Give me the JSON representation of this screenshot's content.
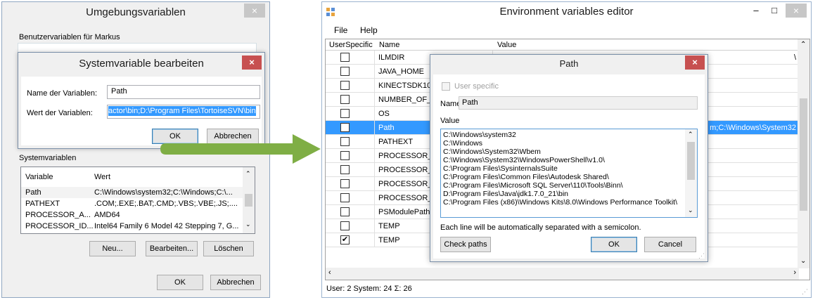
{
  "left_window": {
    "title": "Umgebungsvariablen",
    "close_glyph": "×",
    "user_vars_label": "Benutzervariablen für Markus",
    "system_vars_label": "Systemvariablen",
    "sys_headers": [
      "Variable",
      "Wert"
    ],
    "sys_rows": [
      {
        "name": "Path",
        "value": "C:\\Windows\\system32;C:\\Windows;C:\\..."
      },
      {
        "name": "PATHEXT",
        "value": ".COM;.EXE;.BAT;.CMD;.VBS;.VBE;.JS;...."
      },
      {
        "name": "PROCESSOR_A...",
        "value": "AMD64"
      },
      {
        "name": "PROCESSOR_ID...",
        "value": "Intel64 Family 6 Model 42 Stepping 7, G..."
      }
    ],
    "buttons": {
      "new": "Neu...",
      "edit": "Bearbeiten...",
      "delete": "Löschen",
      "ok": "OK",
      "cancel": "Abbrechen"
    }
  },
  "edit_dialog": {
    "title": "Systemvariable bearbeiten",
    "close_glyph": "×",
    "name_label": "Name der Variablen:",
    "name_value": "Path",
    "value_label": "Wert der Variablen:",
    "value_value": "actor\\bin;D:\\Program Files\\TortoiseSVN\\bin",
    "ok": "OK",
    "cancel": "Abbrechen"
  },
  "arrow": {
    "color": "#7fae45"
  },
  "right_window": {
    "title": "Environment variables editor",
    "min_glyph": "–",
    "max_glyph": "□",
    "close_glyph": "×",
    "menu": [
      "File",
      "Help"
    ],
    "headers": [
      "UserSpecific",
      "Name",
      "Value"
    ],
    "rows": [
      {
        "checked": false,
        "name": "ILMDIR",
        "value": "\\"
      },
      {
        "checked": false,
        "name": "JAVA_HOME",
        "value": ""
      },
      {
        "checked": false,
        "name": "KINECTSDK10_",
        "value": ""
      },
      {
        "checked": false,
        "name": "NUMBER_OF_",
        "value": ""
      },
      {
        "checked": false,
        "name": "OS",
        "value": ""
      },
      {
        "checked": false,
        "name": "Path",
        "value": "m;C:\\Windows\\System32",
        "selected": true
      },
      {
        "checked": false,
        "name": "PATHEXT",
        "value": ""
      },
      {
        "checked": false,
        "name": "PROCESSOR_",
        "value": ""
      },
      {
        "checked": false,
        "name": "PROCESSOR_",
        "value": ""
      },
      {
        "checked": false,
        "name": "PROCESSOR_",
        "value": ""
      },
      {
        "checked": false,
        "name": "PROCESSOR_",
        "value": ""
      },
      {
        "checked": false,
        "name": "PSModulePath",
        "value": ""
      },
      {
        "checked": false,
        "name": "TEMP",
        "value": ""
      },
      {
        "checked": true,
        "name": "TEMP",
        "value": ""
      }
    ],
    "status": "User: 2 System: 24 Σ: 26",
    "selection_color": "#3399ff"
  },
  "path_dialog": {
    "title": "Path",
    "close_glyph": "×",
    "user_specific_label": "User specific",
    "name_label": "Name:",
    "name_value": "Path",
    "value_label": "Value",
    "lines": [
      "C:\\Windows\\system32",
      "C:\\Windows",
      "C:\\Windows\\System32\\Wbem",
      "C:\\Windows\\System32\\WindowsPowerShell\\v1.0\\",
      "C:\\Program Files\\SysinternalsSuite",
      "C:\\Program Files\\Common Files\\Autodesk Shared\\",
      "C:\\Program Files\\Microsoft SQL Server\\110\\Tools\\Binn\\",
      "D:\\Program Files\\Java\\jdk1.7.0_21\\bin",
      "C:\\Program Files (x86)\\Windows Kits\\8.0\\Windows Performance Toolkit\\"
    ],
    "hint": "Each line will be automatically separated with a semicolon.",
    "check_paths": "Check paths",
    "ok": "OK",
    "cancel": "Cancel"
  }
}
